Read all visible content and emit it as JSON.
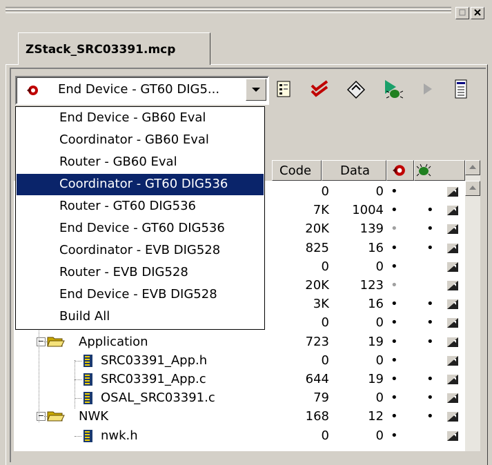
{
  "project_tab": "ZStack_SRC03391.mcp",
  "target_combo": {
    "selected": "End Device - GT60 DIG5..."
  },
  "target_options": [
    "End Device - GB60 Eval",
    "Coordinator - GB60 Eval",
    "Router - GB60 Eval",
    "Coordinator - GT60 DIG536",
    "Router - GT60 DIG536",
    "End Device - GT60 DIG536",
    "Coordinator - EVB DIG528",
    "Router - EVB DIG528",
    "End Device - EVB DIG528",
    "Build All"
  ],
  "columns": {
    "code": "Code",
    "data": "Data"
  },
  "rows": [
    {
      "name": "",
      "code": "0",
      "data": "0",
      "dot1": "•",
      "dot2": "",
      "dot1_grey": false
    },
    {
      "name": "",
      "code": "7K",
      "data": "1004",
      "dot1": "•",
      "dot2": "•",
      "dot1_grey": false
    },
    {
      "name": "",
      "code": "20K",
      "data": "139",
      "dot1": "•",
      "dot2": "•",
      "dot1_grey": true
    },
    {
      "name": "",
      "code": "825",
      "data": "16",
      "dot1": "•",
      "dot2": "•",
      "dot1_grey": false
    },
    {
      "name": "",
      "code": "0",
      "data": "0",
      "dot1": "•",
      "dot2": "",
      "dot1_grey": false
    },
    {
      "name": "",
      "code": "20K",
      "data": "123",
      "dot1": "•",
      "dot2": "",
      "dot1_grey": true
    },
    {
      "name": "",
      "code": "3K",
      "data": "16",
      "dot1": "•",
      "dot2": "•",
      "dot1_grey": false
    },
    {
      "name": "",
      "code": "0",
      "data": "0",
      "dot1": "•",
      "dot2": "•",
      "dot1_grey": false
    },
    {
      "name": "Application",
      "code": "723",
      "data": "19",
      "dot1": "•",
      "dot2": "•",
      "dot1_grey": false
    },
    {
      "name": "SRC03391_App.h",
      "code": "0",
      "data": "0",
      "dot1": "•",
      "dot2": "",
      "dot1_grey": false
    },
    {
      "name": "SRC03391_App.c",
      "code": "644",
      "data": "19",
      "dot1": "•",
      "dot2": "•",
      "dot1_grey": false
    },
    {
      "name": "OSAL_SRC03391.c",
      "code": "79",
      "data": "0",
      "dot1": "•",
      "dot2": "•",
      "dot1_grey": false
    },
    {
      "name": "NWK",
      "code": "168",
      "data": "12",
      "dot1": "•",
      "dot2": "•",
      "dot1_grey": false
    },
    {
      "name": "nwk.h",
      "code": "0",
      "data": "0",
      "dot1": "•",
      "dot2": "",
      "dot1_grey": false
    }
  ],
  "colors": {
    "selection": "#0a246a",
    "chrome": "#d4d0c8"
  }
}
